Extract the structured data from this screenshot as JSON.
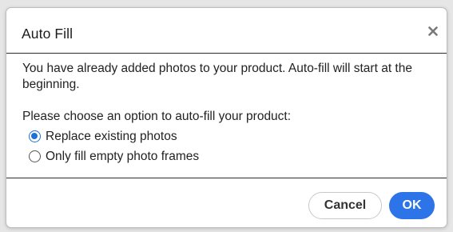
{
  "dialog": {
    "title": "Auto Fill",
    "close_icon": "close-icon",
    "message": "You have already added photos to your product. Auto-fill will start at the beginning.",
    "prompt": "Please choose an option to auto-fill your product:",
    "options": [
      {
        "label": "Replace existing photos",
        "selected": true
      },
      {
        "label": "Only fill empty photo frames",
        "selected": false
      }
    ],
    "buttons": {
      "cancel": "Cancel",
      "ok": "OK"
    }
  },
  "colors": {
    "accent": "#2c74e8",
    "radio_selected": "#1f6fd6",
    "background": "#ffffff"
  }
}
